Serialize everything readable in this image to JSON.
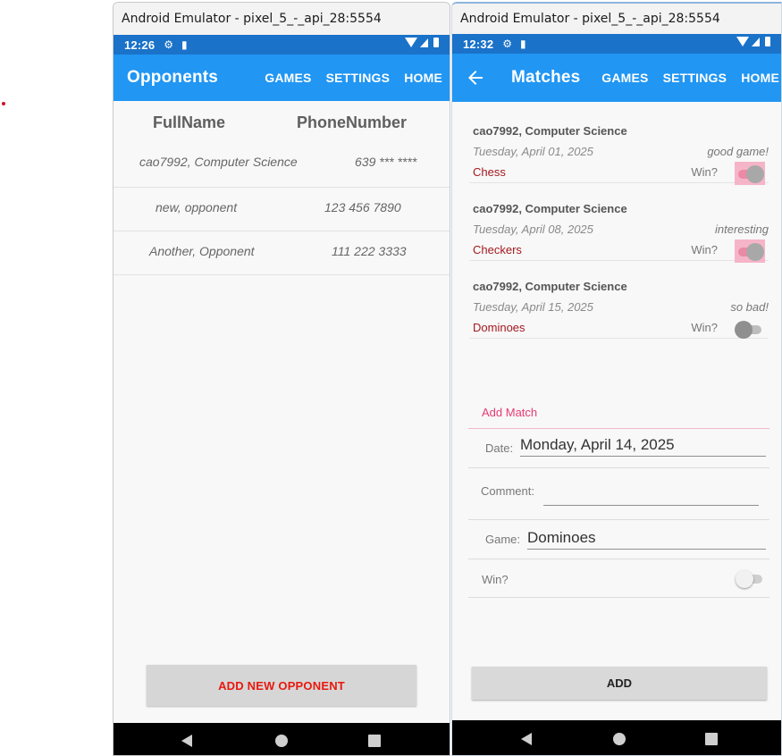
{
  "left": {
    "window_title": "Android Emulator - pixel_5_-_api_28:5554",
    "status_time": "12:26",
    "page_title": "Opponents",
    "nav": [
      "GAMES",
      "SETTINGS",
      "HOME"
    ],
    "columns": [
      "FullName",
      "PhoneNumber"
    ],
    "rows": [
      {
        "name": "cao7992, Computer Science",
        "phone": "639 *** ****"
      },
      {
        "name": "new, opponent",
        "phone": "123 456 7890"
      },
      {
        "name": "Another, Opponent",
        "phone": "111 222 3333"
      }
    ],
    "add_button": "ADD NEW OPPONENT"
  },
  "right": {
    "window_title": "Android Emulator - pixel_5_-_api_28:5554",
    "status_time": "12:32",
    "page_title": "Matches",
    "nav": [
      "GAMES",
      "SETTINGS",
      "HOME"
    ],
    "matches": [
      {
        "who": "cao7992, Computer Science",
        "date": "Tuesday, April 01, 2025",
        "comment": "good game!",
        "game": "Chess",
        "win_label": "Win?",
        "win": true
      },
      {
        "who": "cao7992, Computer Science",
        "date": "Tuesday, April 08, 2025",
        "comment": "interesting",
        "game": "Checkers",
        "win_label": "Win?",
        "win": true
      },
      {
        "who": "cao7992, Computer Science",
        "date": "Tuesday, April 15, 2025",
        "comment": "so bad!",
        "game": "Dominoes",
        "win_label": "Win?",
        "win": false
      }
    ],
    "add_match": {
      "header": "Add Match",
      "date_label": "Date:",
      "date_value": "Monday, April 14, 2025",
      "comment_label": "Comment:",
      "comment_value": "",
      "game_label": "Game:",
      "game_value": "Dominoes",
      "win_label": "Win?",
      "win": false
    },
    "add_button": "ADD"
  },
  "colors": {
    "status_bar": "#1a72c9",
    "app_bar": "#2196f3",
    "accent_pink": "#e83a75",
    "game_red": "#a2191f",
    "add_opponent_text": "#e8190f"
  }
}
